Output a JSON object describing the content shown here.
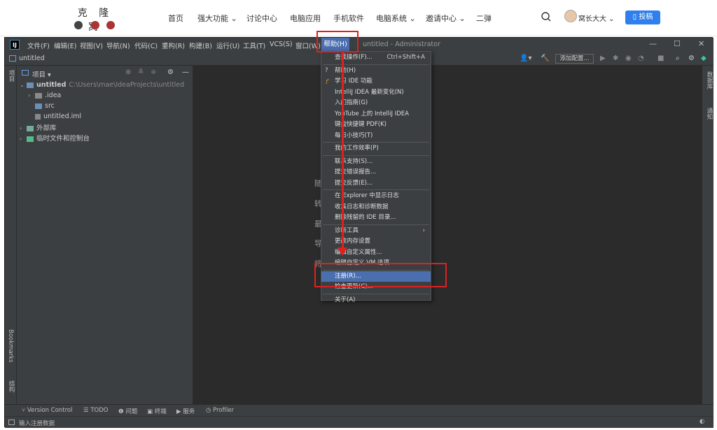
{
  "site": {
    "logo_text": "克 隆 窝",
    "nav": [
      "首页",
      "强大功能 ⌄",
      "讨论中心",
      "电脑应用",
      "手机软件",
      "电脑系统 ⌄",
      "邀请中心 ⌄",
      "二弹"
    ],
    "user_name": "窝长大大 ⌄",
    "submit_label": "▯ 投稿"
  },
  "ide": {
    "menus": [
      "文件(F)",
      "编辑(E)",
      "视图(V)",
      "导航(N)",
      "代码(C)",
      "重构(R)",
      "构建(B)",
      "运行(U)",
      "工具(T)",
      "VCS(S)",
      "窗口(W)"
    ],
    "help_menu": "帮助(H)",
    "window_title": "untitled - Administrator",
    "breadcrumb": "untitled",
    "add_config": "添加配置...",
    "project_label": "项目",
    "panel_title": "项目  ▾",
    "tree": {
      "root": "untitled",
      "root_path": "C:\\Users\\mae\\IdeaProjects\\untitled",
      "idea": ".idea",
      "src": "src",
      "iml": "untitled.iml",
      "external": "外部库",
      "scratch": "临时文件和控制台"
    },
    "editor_hints": [
      "随",
      "转",
      "最",
      "导",
      "将"
    ],
    "bottom_tools": [
      "Version Control",
      "TODO",
      "问题",
      "终端",
      "服务",
      "Profiler"
    ],
    "left_vertical": [
      "项目",
      "Bookmarks",
      "结构"
    ],
    "right_vertical": [
      "数据库",
      "通知"
    ],
    "status": "输入注册数据",
    "help_items": [
      {
        "label": "查找操作(F)...",
        "shortcut": "Ctrl+Shift+A"
      },
      {
        "sep": true
      },
      {
        "label": "帮助(H)",
        "icon": "?"
      },
      {
        "label": "学习 IDE 功能",
        "icon": "🎓"
      },
      {
        "label": "IntelliJ IDEA 最新变化(N)"
      },
      {
        "label": "入门指南(G)"
      },
      {
        "label": "YouTube 上的 IntelliJ IDEA"
      },
      {
        "label": "键盘快捷键 PDF(K)"
      },
      {
        "label": "每日小技巧(T)"
      },
      {
        "sep": true
      },
      {
        "label": "我的工作效率(P)"
      },
      {
        "sep": true
      },
      {
        "label": "联系支持(S)..."
      },
      {
        "label": "提交错误报告..."
      },
      {
        "label": "提交反馈(E)..."
      },
      {
        "sep": true
      },
      {
        "label": "在 Explorer 中显示日志"
      },
      {
        "label": "收集日志和诊断数据"
      },
      {
        "label": "删除残留的 IDE 目录..."
      },
      {
        "sep": true
      },
      {
        "label": "诊断工具",
        "submenu": true
      },
      {
        "label": "更改内存设置"
      },
      {
        "label": "编辑自定义属性..."
      },
      {
        "label": "编辑自定义 VM 选项..."
      },
      {
        "sep": true
      },
      {
        "label": "注册(R)...",
        "selected": true
      },
      {
        "label": "检查更新(C)..."
      },
      {
        "sep": true
      },
      {
        "label": "关于(A)"
      }
    ]
  },
  "colors": {
    "accent": "#4b6eaf",
    "annotation": "#e02020",
    "submit": "#2f80ed"
  }
}
